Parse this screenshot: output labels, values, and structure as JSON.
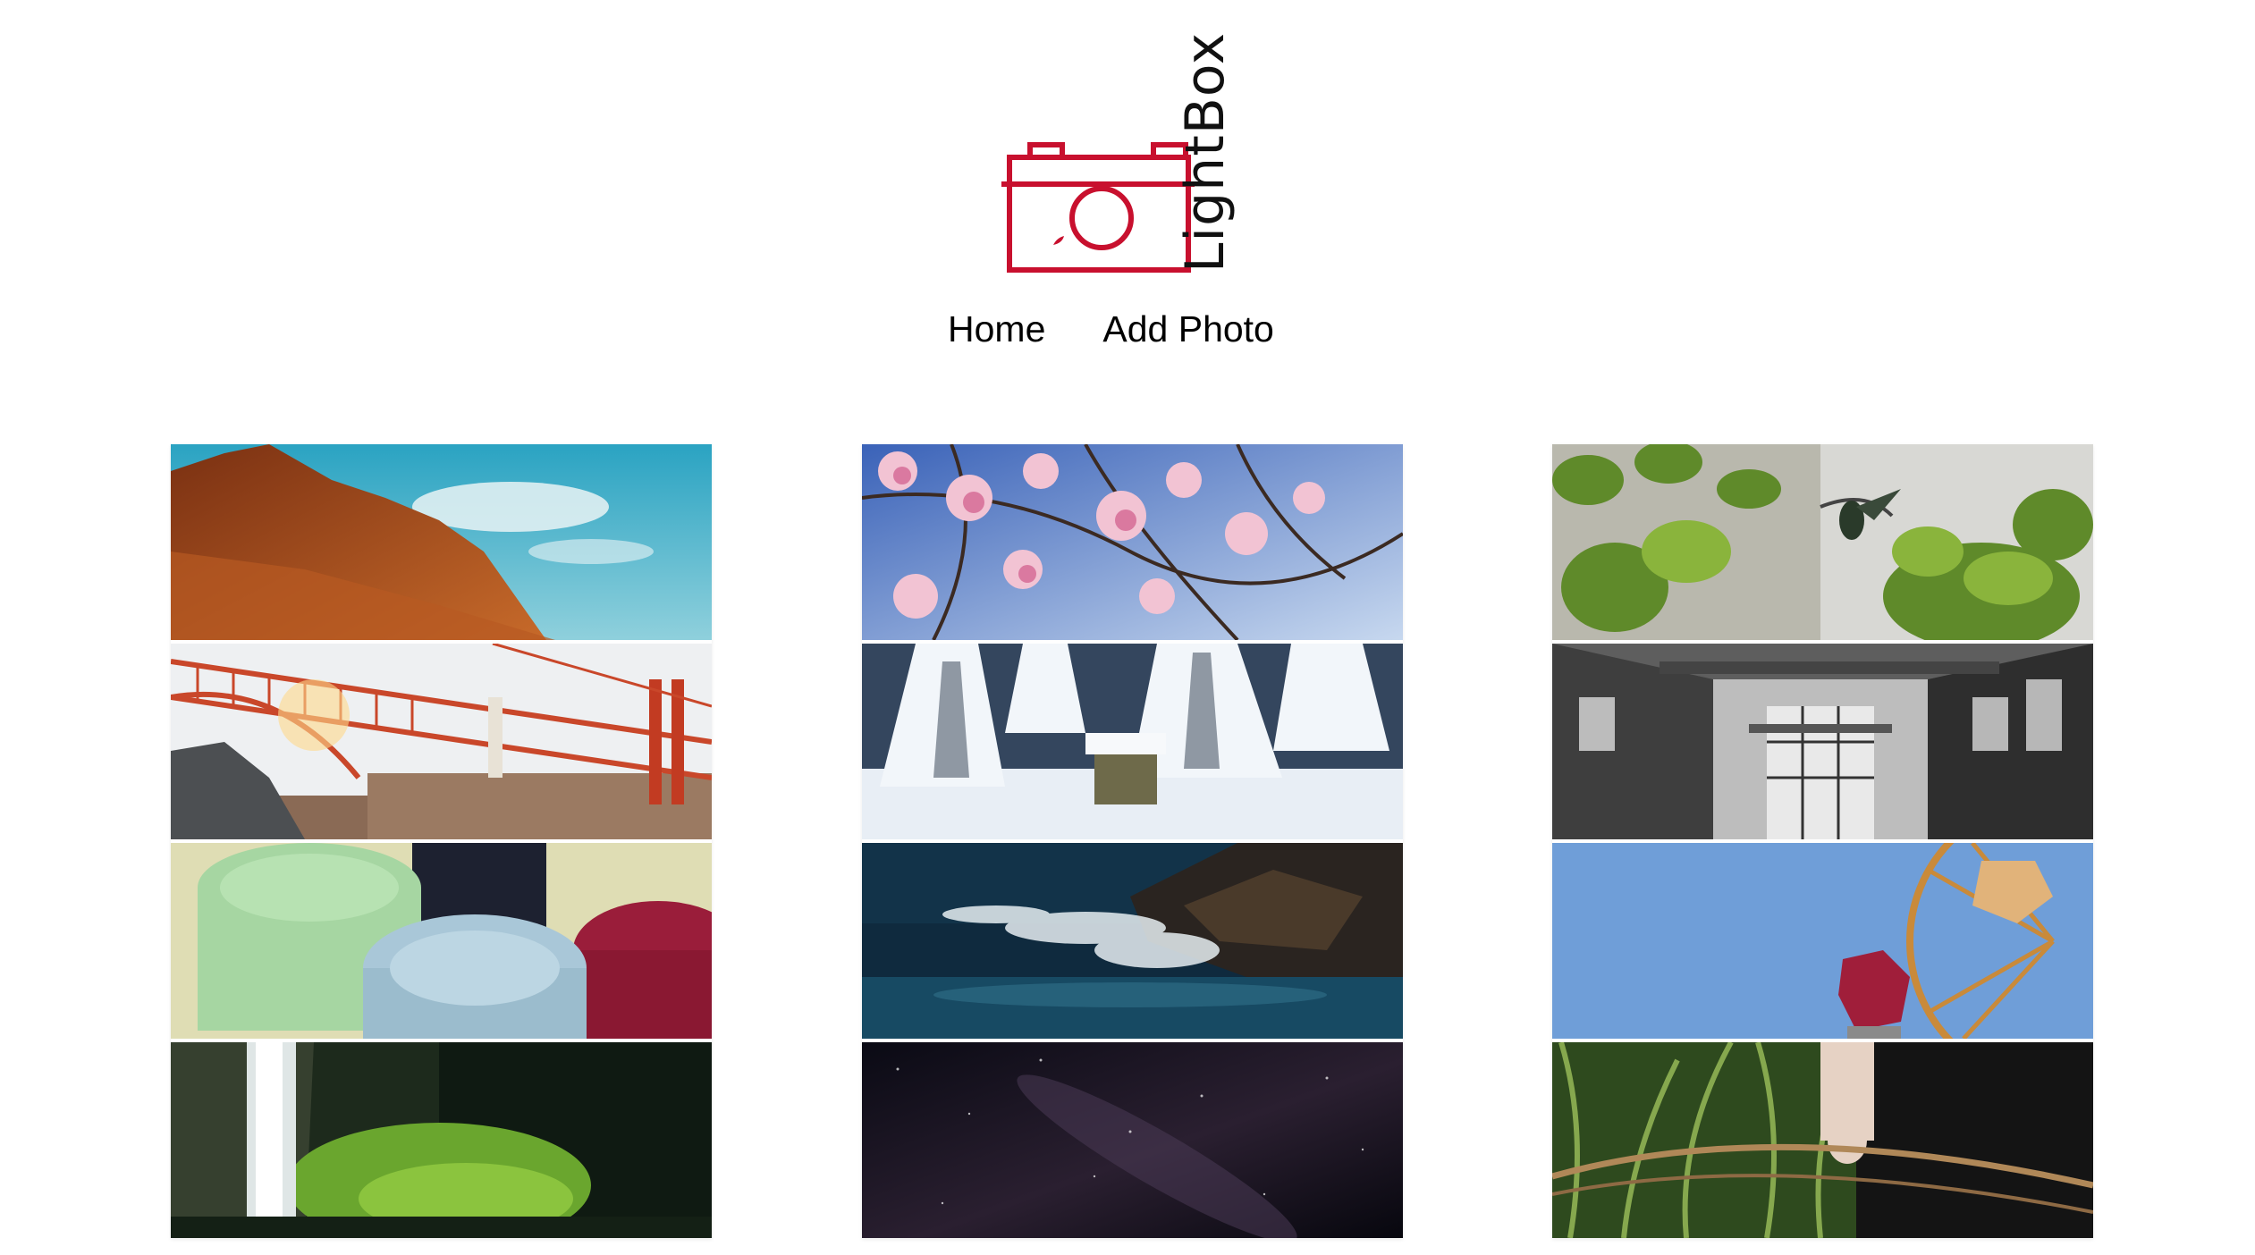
{
  "brand": {
    "name": "LightBox",
    "logo_icon": "camera-icon",
    "accent_color": "#c8102e"
  },
  "nav": {
    "items": [
      {
        "label": "Home"
      },
      {
        "label": "Add Photo"
      }
    ]
  },
  "gallery": {
    "columns": [
      {
        "photos": [
          {
            "subject": "red-cliff-mountain-photo"
          },
          {
            "subject": "golden-gate-bridge-photo"
          },
          {
            "subject": "poker-chips-photo"
          },
          {
            "subject": "waterfall-photo"
          }
        ]
      },
      {
        "photos": [
          {
            "subject": "magnolia-blossoms-photo"
          },
          {
            "subject": "snowy-forest-photo"
          },
          {
            "subject": "ocean-wave-rocks-photo"
          },
          {
            "subject": "milky-way-night-sky-photo"
          }
        ]
      },
      {
        "photos": [
          {
            "subject": "hummingbird-photo"
          },
          {
            "subject": "abandoned-factory-photo"
          },
          {
            "subject": "ferris-wheel-photo"
          },
          {
            "subject": "cornfield-figure-photo"
          }
        ]
      }
    ]
  }
}
